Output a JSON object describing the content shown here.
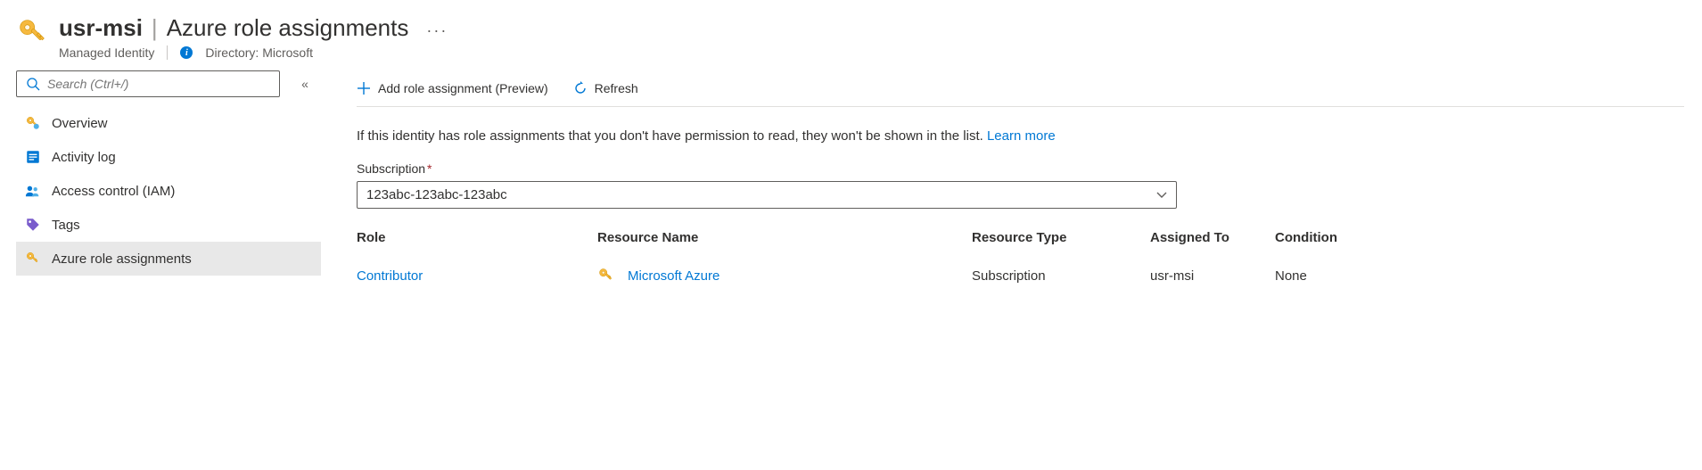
{
  "header": {
    "resource_name": "usr-msi",
    "page_title": "Azure role assignments",
    "resource_type": "Managed Identity",
    "directory_label": "Directory:",
    "directory_value": "Microsoft",
    "more_glyph": "···"
  },
  "sidebar": {
    "search_placeholder": "Search (Ctrl+/)",
    "collapse_glyph": "«",
    "items": [
      {
        "label": "Overview"
      },
      {
        "label": "Activity log"
      },
      {
        "label": "Access control (IAM)"
      },
      {
        "label": "Tags"
      },
      {
        "label": "Azure role assignments"
      }
    ]
  },
  "toolbar": {
    "add_label": "Add role assignment (Preview)",
    "refresh_label": "Refresh"
  },
  "main": {
    "info_text": "If this identity has role assignments that you don't have permission to read, they won't be shown in the list. ",
    "learn_more": "Learn more",
    "subscription_label": "Subscription",
    "subscription_value": "123abc-123abc-123abc"
  },
  "table": {
    "headers": {
      "role": "Role",
      "resource": "Resource Name",
      "type": "Resource Type",
      "assigned": "Assigned To",
      "condition": "Condition"
    },
    "rows": [
      {
        "role": "Contributor",
        "resource": "Microsoft Azure",
        "type": "Subscription",
        "assigned": "usr-msi",
        "condition": "None"
      }
    ]
  }
}
